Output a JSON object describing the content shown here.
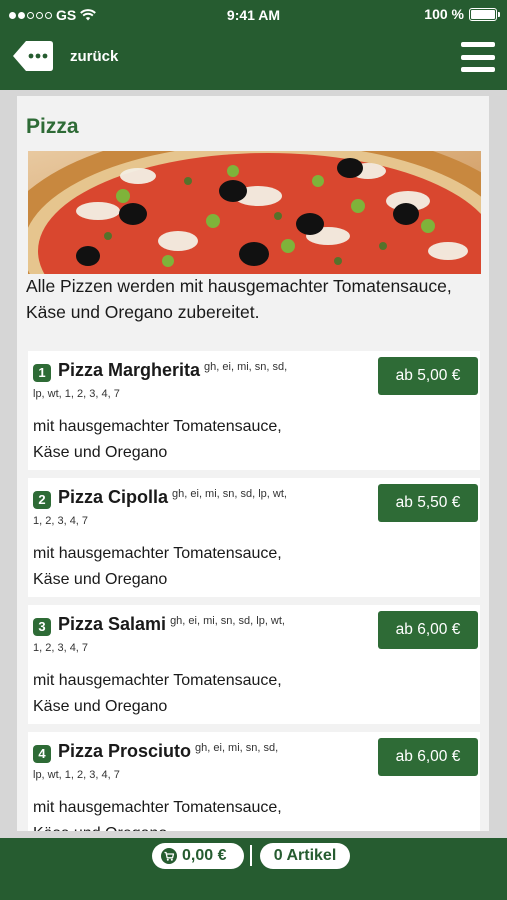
{
  "status_bar": {
    "carrier": "GS",
    "time": "9:41 AM",
    "battery": "100 %"
  },
  "nav": {
    "back_label": "zurück",
    "back_icon": "back-arrow-icon",
    "menu_icon": "hamburger-menu-icon"
  },
  "category": {
    "title": "Pizza",
    "image": "pizza-photo",
    "description": "Alle Pizzen werden mit hausgemachter Tomatensauce, Käse und Oregano zubereitet."
  },
  "items": [
    {
      "number": "1",
      "name": "Pizza Margherita",
      "allergens_line1": "gh, ei, mi, sn, sd,",
      "allergens_line2": "lp, wt, 1, 2, 3, 4, 7",
      "desc_line1": "mit hausgemachter Tomatensauce,",
      "desc_line2": "Käse und Oregano",
      "price": "ab 5,00 €"
    },
    {
      "number": "2",
      "name": "Pizza Cipolla",
      "allergens_line1": "gh, ei, mi, sn, sd, lp, wt,",
      "allergens_line2": "1, 2, 3, 4, 7",
      "desc_line1": "mit hausgemachter Tomatensauce,",
      "desc_line2": "Käse und Oregano",
      "price": "ab 5,50 €"
    },
    {
      "number": "3",
      "name": "Pizza Salami",
      "allergens_line1": "gh, ei, mi, sn, sd, lp, wt,",
      "allergens_line2": "1, 2, 3, 4, 7",
      "desc_line1": "mit hausgemachter Tomatensauce,",
      "desc_line2": "Käse und Oregano",
      "price": "ab 6,00 €"
    },
    {
      "number": "4",
      "name": "Pizza Prosciuto",
      "allergens_line1": "gh, ei, mi, sn, sd,",
      "allergens_line2": "lp, wt, 1, 2, 3, 4, 7",
      "desc_line1": "mit hausgemachter Tomatensauce,",
      "desc_line2": "Käse und Oregano",
      "price": "ab 6,00 €"
    }
  ],
  "footer": {
    "cart_total": "0,00 €",
    "item_count": "0 Artikel",
    "cart_icon": "shopping-cart-icon"
  },
  "colors": {
    "brand_green": "#265c30",
    "button_green": "#2e6b36"
  }
}
